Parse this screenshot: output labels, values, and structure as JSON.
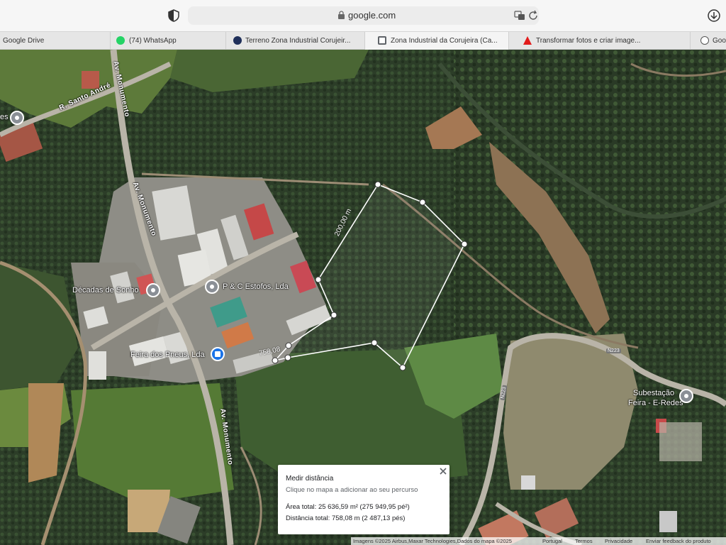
{
  "browser": {
    "url": "google.com",
    "tabs": [
      {
        "label": "Google Drive",
        "icon": "google-drive-icon",
        "color": "#34a853"
      },
      {
        "label": "(74) WhatsApp",
        "icon": "whatsapp-icon",
        "color": "#25d366"
      },
      {
        "label": "Terreno Zona Industrial Corujeir...",
        "icon": "site-icon",
        "color": "#1f2f5a"
      },
      {
        "label": "Zona Industrial da Corujeira (Ca...",
        "icon": "maps-icon",
        "color": "#5f6368",
        "active": true
      },
      {
        "label": "Transformar fotos e criar image...",
        "icon": "adobe-icon",
        "color": "#e21b1b"
      },
      {
        "label": "Google",
        "icon": "google-icon",
        "color": "#555555"
      }
    ]
  },
  "map": {
    "places": {
      "decadas": "Décadas de Sonho",
      "estofos": "P & C Estofos, Lda",
      "feira_pneus": "Feira dos Pneus, Lda",
      "subestacao_line1": "Subestação",
      "subestacao_line2": "Feira - E-Redes",
      "left_cut": "es"
    },
    "roads": {
      "santo_andre": "R. Santo André",
      "monumento_top": "Av. Monumento",
      "monumento_mid": "Av. Monumento",
      "monumento_bottom": "Av. Monumento",
      "n223_a": "N223",
      "n223_b": "N223"
    },
    "measure": {
      "segment_label": "200,00 m",
      "end_label": "758,08"
    }
  },
  "measure_panel": {
    "title": "Medir distância",
    "hint": "Clique no mapa a adicionar ao seu percurso",
    "area": "Área total: 25 636,59 m² (275 949,95 pé²)",
    "distance": "Distância total: 758,08 m (2 487,13 pés)"
  },
  "attribution": {
    "imagery": "Imagens ©2025 Airbus,Maxar Technologies,Dados do mapa ©2025",
    "country": "Portugal",
    "terms": "Termos",
    "privacy": "Privacidade",
    "feedback": "Enviar feedback do produto"
  },
  "colors": {
    "forest_dark": "#243322",
    "forest": "#33472c",
    "field": "#6b8a3e",
    "road": "#b9b4a8",
    "dirt": "#b58a5e",
    "measure_line": "#ffffff",
    "accent_blue": "#1a73e8"
  }
}
